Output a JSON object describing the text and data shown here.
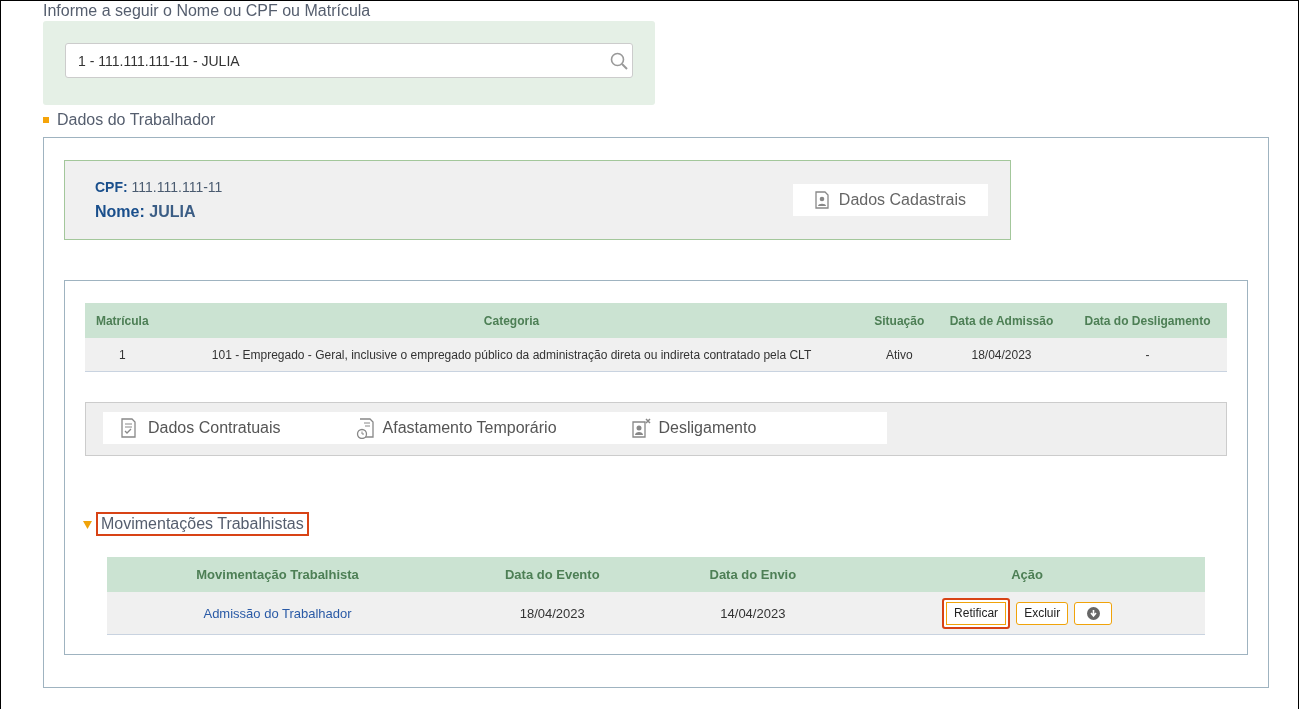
{
  "search": {
    "label": "Informe a seguir o Nome ou CPF ou Matrícula",
    "value": "1 - 111.111.111-11 - JULIA"
  },
  "section_title": "Dados do Trabalhador",
  "worker": {
    "cpf_label": "CPF:",
    "cpf": "111.111.111-11",
    "name_label": "Nome:",
    "name": "JULIA",
    "button": "Dados Cadastrais"
  },
  "contracts_table": {
    "columns": [
      "Matrícula",
      "Categoria",
      "Situação",
      "Data de Admissão",
      "Data do Desligamento"
    ],
    "rows": [
      [
        "1",
        "101 - Empregado - Geral, inclusive o empregado público da administração direta ou indireta contratado pela CLT",
        "Ativo",
        "18/04/2023",
        "-"
      ]
    ]
  },
  "actions": [
    {
      "kind": "contract",
      "label": "Dados Contratuais"
    },
    {
      "kind": "leave",
      "label": "Afastamento Temporário"
    },
    {
      "kind": "dismissal",
      "label": "Desligamento"
    }
  ],
  "movements": {
    "title": "Movimentações Trabalhistas",
    "expanded": true,
    "highlighted": true,
    "columns": [
      "Movimentação Trabalhista",
      "Data do Evento",
      "Data do Envio",
      "Ação"
    ],
    "rows": [
      {
        "event": "Admissão do Trabalhador",
        "event_date": "18/04/2023",
        "sent_date": "14/04/2023",
        "buttons": [
          {
            "kind": "text",
            "label": "Retificar",
            "highlighted": true
          },
          {
            "kind": "text",
            "label": "Excluir",
            "highlighted": false
          },
          {
            "kind": "download",
            "highlighted": false
          }
        ]
      }
    ]
  }
}
